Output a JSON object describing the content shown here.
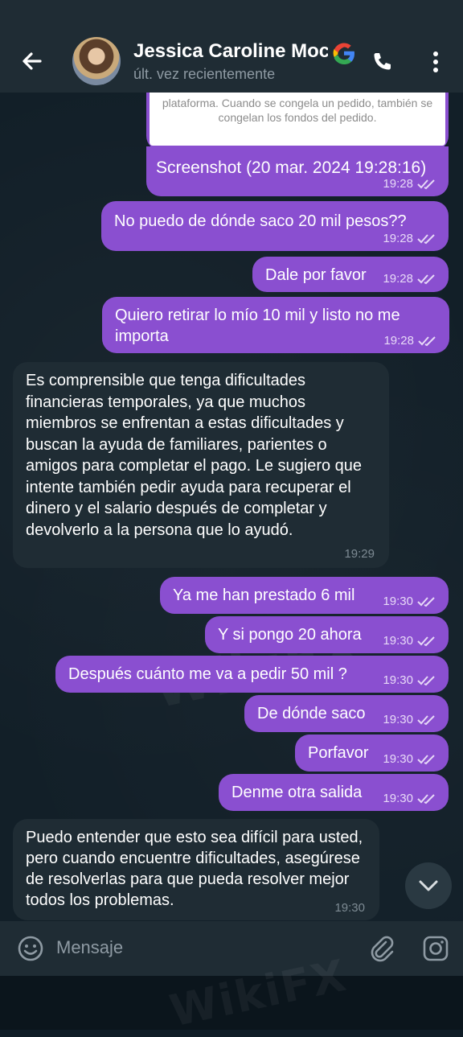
{
  "header": {
    "contact_name": "Jessica Caroline Moc",
    "status": "últ. vez recientemente",
    "icons": [
      "back-arrow-icon",
      "google-icon",
      "phone-icon",
      "more-vert-icon"
    ]
  },
  "quoted_message": {
    "text": "plataforma. Cuando se congela un pedido, también se congelan los fondos del pedido."
  },
  "messages": [
    {
      "dir": "out",
      "text": "Screenshot (20 mar. 2024 19:28:16)",
      "time": "19:28"
    },
    {
      "dir": "out",
      "text": "No puedo de dónde saco 20 mil pesos??",
      "time": "19:28"
    },
    {
      "dir": "out",
      "text": "Dale por favor",
      "time": "19:28"
    },
    {
      "dir": "out",
      "text": "Quiero retirar lo mío 10 mil y listo no me importa",
      "time": "19:28"
    },
    {
      "dir": "in",
      "text": "Es comprensible que tenga dificultades financieras temporales, ya que muchos miembros se enfrentan a estas dificultades y buscan la ayuda de familiares, parientes o amigos para completar el pago. Le sugiero que intente también pedir ayuda para recuperar el dinero y el salario después de completar y devolverlo a la persona que lo ayudó.",
      "time": "19:29"
    },
    {
      "dir": "out",
      "text": "Ya me han prestado 6 mil",
      "time": "19:30"
    },
    {
      "dir": "out",
      "text": "Y si pongo 20 ahora",
      "time": "19:30"
    },
    {
      "dir": "out",
      "text": "Después cuánto me va a pedir 50 mil ?",
      "time": "19:30"
    },
    {
      "dir": "out",
      "text": "De dónde saco",
      "time": "19:30"
    },
    {
      "dir": "out",
      "text": "Porfavor",
      "time": "19:30"
    },
    {
      "dir": "out",
      "text": "Denme otra salida",
      "time": "19:30"
    },
    {
      "dir": "in",
      "text": "Puedo entender que esto sea difícil para usted, pero cuando encuentre dificultades, asegúrese de resolverlas para que pueda resolver mejor todos los problemas.",
      "time": "19:30"
    }
  ],
  "input": {
    "placeholder": "Mensaje",
    "icons": [
      "emoji-icon",
      "attach-icon",
      "camera-icon"
    ]
  },
  "scroll_button_icon": "chevron-down-icon",
  "watermark": "WikiFX",
  "colors": {
    "outgoing_bubble": "#8a4fd0",
    "incoming_bubble": "#1f2c34",
    "header": "#1f2c34",
    "chat_background": "#121f28"
  }
}
